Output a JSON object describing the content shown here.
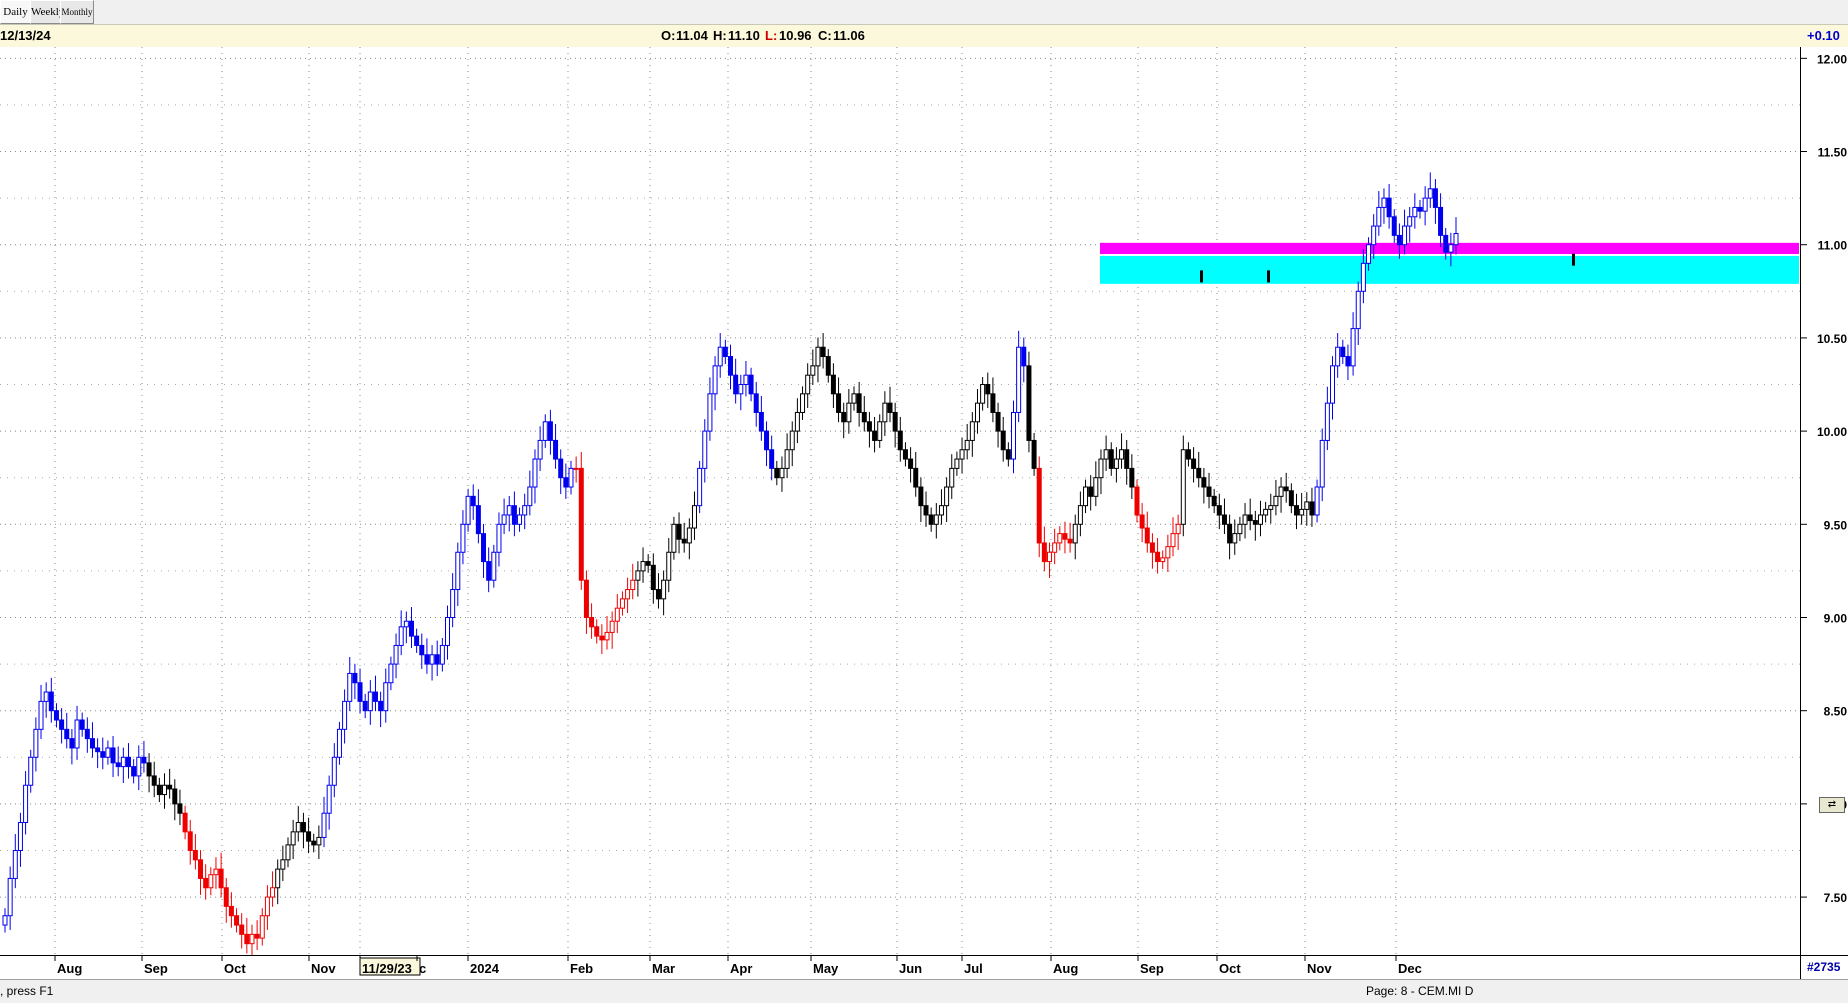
{
  "tabs": [
    "Daily",
    "Weekly",
    "Monthly"
  ],
  "info": {
    "date": "12/13/24",
    "ohlc": [
      {
        "k": "O:",
        "v": "11.04",
        "color": "#000000"
      },
      {
        "k": "H:",
        "v": "11.10",
        "color": "#000000"
      },
      {
        "k": "L:",
        "v": "10.96",
        "color": "#cc0000"
      },
      {
        "k": "C:",
        "v": "11.06",
        "color": "#000000"
      }
    ],
    "change": "+0.10"
  },
  "xaxis_labels": [
    "Aug",
    "Sep",
    "Oct",
    "Nov",
    "11/29/23",
    "c",
    "2024",
    "Feb",
    "Mar",
    "Apr",
    "May",
    "Jun",
    "Jul",
    "Aug",
    "Sep",
    "Oct",
    "Nov",
    "Dec"
  ],
  "xaxis_right": "#2735",
  "status": {
    "hint": ", press F1",
    "page": "Page: 8 - CEM.MI D"
  },
  "chart_data": {
    "type": "ohlc",
    "symbol": "CEM.MI",
    "period": "Daily",
    "ylim": [
      7.2,
      12.05
    ],
    "yticks": [
      "12.00",
      "11.50",
      "11.00",
      "10.50",
      "10.00",
      "9.50",
      "9.00",
      "8.50",
      "8.00",
      "7.50"
    ],
    "grid": true,
    "colors": {
      "up_trend": "#0000ee",
      "down_trend": "#ee0000",
      "neutral": "#000000"
    },
    "zones": [
      {
        "from": 10.95,
        "to": 11.01,
        "color": "#ff00ff"
      },
      {
        "from": 10.79,
        "to": 10.94,
        "color": "#00ffff"
      }
    ],
    "markers": [
      10.83,
      10.83,
      10.92
    ],
    "series": [
      {
        "label": "Jul-2023",
        "trend": "blue",
        "closes": [
          7.4,
          7.6,
          7.75,
          7.9,
          8.1,
          8.25,
          8.4,
          8.55,
          8.6,
          8.5,
          8.45,
          8.4,
          8.35,
          8.3,
          8.45,
          8.4,
          8.35,
          8.3,
          8.28,
          8.25,
          8.3,
          8.22,
          8.2,
          8.25,
          8.2,
          8.15,
          8.25,
          8.22
        ]
      },
      {
        "label": "Aug-Sep 2023",
        "trend": "black",
        "closes": [
          8.15,
          8.1,
          8.05,
          8.1,
          8.08,
          8.0,
          7.95
        ]
      },
      {
        "label": "Sep-Oct 2023",
        "trend": "red",
        "closes": [
          7.85,
          7.75,
          7.7,
          7.6,
          7.55,
          7.62,
          7.65,
          7.55,
          7.45,
          7.4,
          7.35,
          7.3,
          7.25,
          7.3,
          7.28,
          7.4,
          7.5,
          7.55
        ]
      },
      {
        "label": "Oct-Nov 2023",
        "trend": "black",
        "closes": [
          7.65,
          7.7,
          7.78,
          7.85,
          7.9,
          7.85,
          7.8,
          7.78,
          7.82
        ]
      },
      {
        "label": "Nov 2023",
        "trend": "blue",
        "closes": [
          7.95,
          8.1,
          8.25,
          8.4,
          8.55,
          8.7,
          8.65,
          8.55,
          8.5,
          8.6,
          8.55,
          8.5,
          8.65,
          8.75,
          8.85,
          8.95,
          8.98,
          8.9,
          8.85,
          8.8,
          8.75,
          8.8,
          8.75,
          8.85,
          9.0,
          9.15,
          9.35,
          9.5,
          9.65,
          9.6,
          9.45,
          9.3,
          9.2,
          9.35,
          9.5,
          9.55,
          9.6,
          9.5,
          9.55,
          9.6,
          9.7,
          9.85,
          9.95,
          10.05,
          9.95,
          9.85,
          9.75,
          9.7,
          9.8
        ]
      },
      {
        "label": "Feb 2024",
        "trend": "red",
        "closes": [
          9.8,
          9.2,
          9.0,
          8.95,
          8.9,
          8.88,
          8.92,
          8.98,
          9.05,
          9.1,
          9.15,
          9.2
        ]
      },
      {
        "label": "Feb-Mar 2024",
        "trend": "black",
        "closes": [
          9.25,
          9.3,
          9.28,
          9.15,
          9.1,
          9.2,
          9.35,
          9.5,
          9.42,
          9.4,
          9.48,
          9.6
        ]
      },
      {
        "label": "Mar-Apr 2024",
        "trend": "blue",
        "closes": [
          9.8,
          10.0,
          10.2,
          10.35,
          10.45,
          10.4,
          10.3,
          10.2,
          10.25,
          10.3,
          10.2,
          10.1,
          10.0,
          9.9,
          9.8
        ]
      },
      {
        "label": "Apr-Jul 2024",
        "trend": "black",
        "closes": [
          9.75,
          9.8,
          9.9,
          10.0,
          10.1,
          10.2,
          10.3,
          10.35,
          10.45,
          10.4,
          10.3,
          10.2,
          10.1,
          10.05,
          10.15,
          10.2,
          10.1,
          10.05,
          10.0,
          9.95,
          10.05,
          10.15,
          10.1,
          10.0,
          9.9,
          9.85,
          9.8,
          9.7,
          9.6,
          9.55,
          9.5,
          9.55,
          9.6,
          9.7,
          9.8,
          9.85,
          9.9,
          9.95,
          10.05,
          10.15,
          10.25,
          10.2,
          10.1,
          10.0,
          9.9,
          9.85
        ]
      },
      {
        "label": "Jul 2024",
        "trend": "blue",
        "closes": [
          10.1,
          10.45,
          10.35
        ]
      },
      {
        "label": "Jul-Aug 2024",
        "trend": "black",
        "closes": [
          9.95,
          9.8
        ]
      },
      {
        "label": "Aug 2024",
        "trend": "red",
        "closes": [
          9.4,
          9.3,
          9.35,
          9.4,
          9.45,
          9.42,
          9.4
        ]
      },
      {
        "label": "Aug-Sep 2024",
        "trend": "black",
        "closes": [
          9.5,
          9.6,
          9.7,
          9.65,
          9.75,
          9.85,
          9.9,
          9.8,
          9.85,
          9.9,
          9.8,
          9.7
        ]
      },
      {
        "label": "Sep 2024",
        "trend": "red",
        "closes": [
          9.55,
          9.48,
          9.4,
          9.35,
          9.3,
          9.32,
          9.38,
          9.45,
          9.5
        ]
      },
      {
        "label": "Sep-Nov 2024",
        "trend": "black",
        "closes": [
          9.9,
          9.85,
          9.8,
          9.75,
          9.7,
          9.65,
          9.6,
          9.55,
          9.5,
          9.4,
          9.45,
          9.5,
          9.55,
          9.52,
          9.5,
          9.55,
          9.58,
          9.6,
          9.65,
          9.7,
          9.68,
          9.6,
          9.55,
          9.58,
          9.62,
          9.55
        ]
      },
      {
        "label": "Nov-Dec 2024",
        "trend": "blue",
        "closes": [
          9.7,
          9.95,
          10.15,
          10.35,
          10.45,
          10.4,
          10.35,
          10.55,
          10.75,
          10.9,
          11.0,
          11.1,
          11.2,
          11.25,
          11.15,
          11.05,
          11.0,
          11.1,
          11.15,
          11.2,
          11.18,
          11.25,
          11.3,
          11.2,
          11.05,
          10.96,
          11.0,
          11.06
        ]
      }
    ]
  }
}
